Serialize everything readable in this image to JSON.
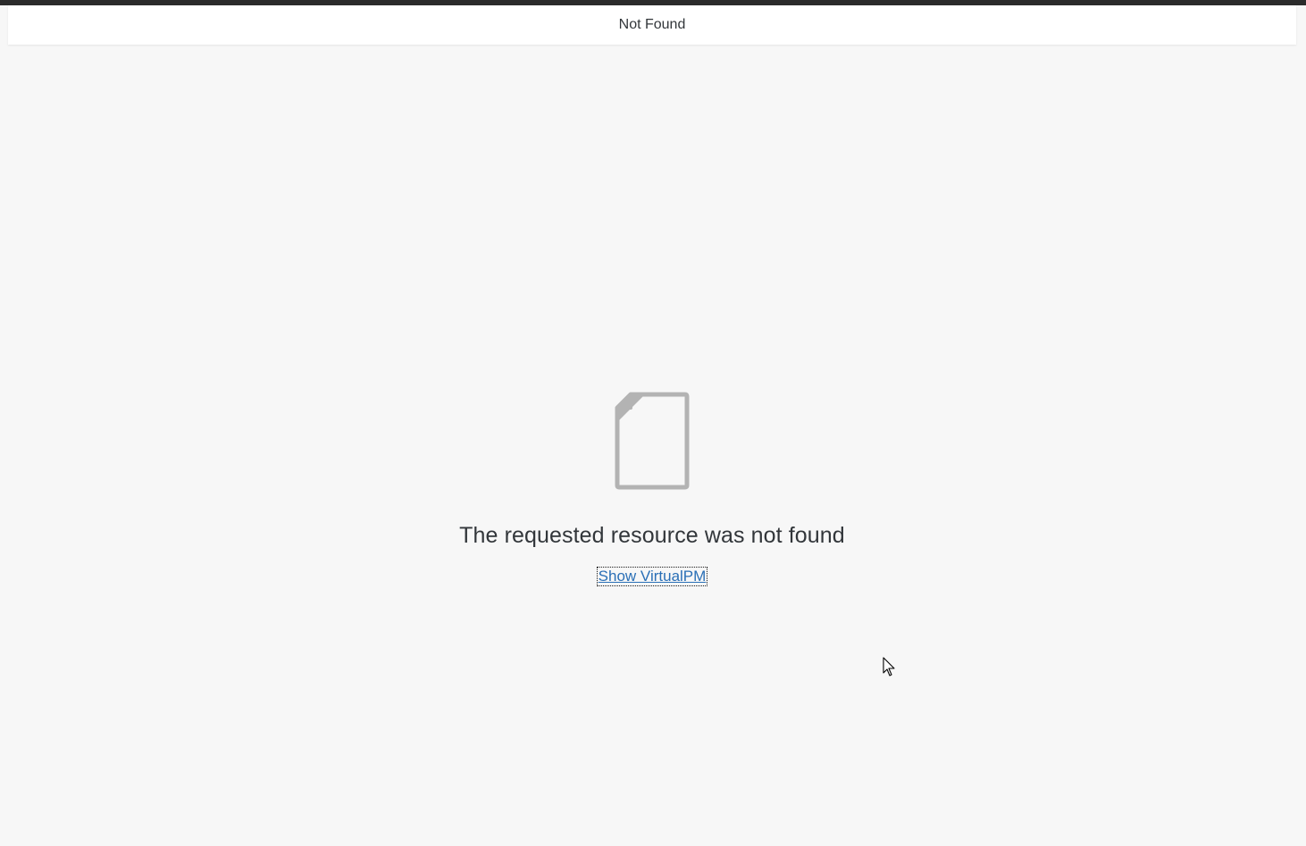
{
  "header": {
    "title": "Not Found"
  },
  "main": {
    "icon": "document-icon",
    "message": "The requested resource was not found",
    "link_label": "Show VirtualPM"
  },
  "colors": {
    "background": "#f7f7f7",
    "header_background": "#ffffff",
    "text": "#32363a",
    "link": "#2a6fb6",
    "icon": "#b3b3b3"
  }
}
